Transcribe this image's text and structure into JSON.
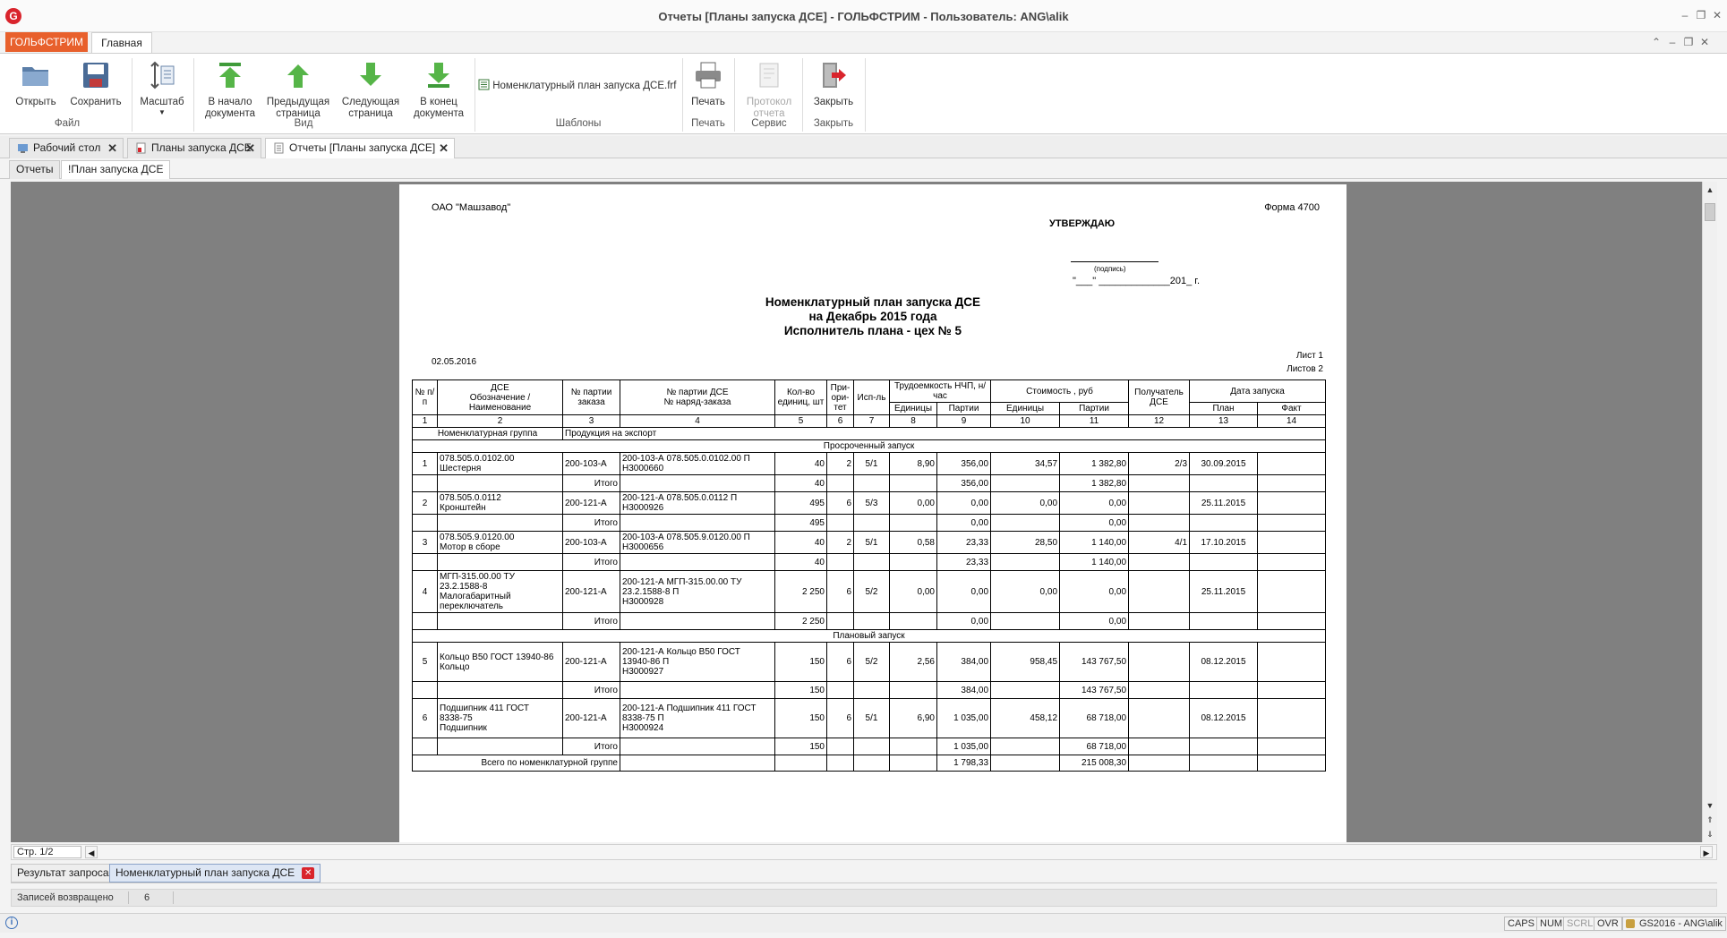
{
  "window": {
    "title": "Отчеты  [Планы запуска ДСЕ] - ГОЛЬФСТРИМ - Пользователь: ANG\\alik",
    "logo_letter": "G"
  },
  "ribbon": {
    "app_tab": "ГОЛЬФСТРИМ",
    "main_tab": "Главная",
    "buttons": {
      "open": "Открыть",
      "save": "Сохранить",
      "zoom": "Масштаб",
      "first_page": [
        "В начало",
        "документа"
      ],
      "prev_page": [
        "Предыдущая",
        "страница"
      ],
      "next_page": [
        "Следующая",
        "страница"
      ],
      "last_page": [
        "В конец",
        "документа"
      ],
      "template": "Номенклатурный план запуска ДСЕ.frf",
      "print": "Печать",
      "protocol": [
        "Протокол",
        "отчета"
      ],
      "close": "Закрыть"
    },
    "groups": {
      "file": "Файл",
      "view": "Вид",
      "templates": "Шаблоны",
      "print": "Печать",
      "service": "Сервис",
      "close": "Закрыть"
    }
  },
  "doc_tabs": [
    {
      "label": "Рабочий стол"
    },
    {
      "label": "Планы запуска ДСЕ"
    },
    {
      "label": "Отчеты  [Планы запуска ДСЕ]"
    }
  ],
  "sub_tabs": [
    "Отчеты",
    "!План запуска ДСЕ"
  ],
  "report": {
    "org": "ОАО \"Машзавод\"",
    "form": "Форма 4700",
    "approve": "УТВЕРЖДАЮ",
    "sign_caption": "(подпись)",
    "date_line": "\"___\" _____________201_ г.",
    "title1": "Номенклатурный план запуска ДСЕ",
    "title2": "на Декабрь 2015 года",
    "title3": "Исполнитель плана - цех № 5",
    "date": "02.05.2016",
    "sheet": "Лист 1",
    "sheets": "Листов 2",
    "headers": {
      "num": "№ п/п",
      "dse": "ДСЕ",
      "dse_sub": "Обозначение / Наименование",
      "batch": "№ партии заказа",
      "batch_dse": "№ партии ДСЕ",
      "work_order": "№ наряд-заказа",
      "qty": "Кол-во единиц, шт",
      "priority": "При- ори- тет",
      "executor": "Исп-ль",
      "labor": "Трудоемкость НЧП, н/час",
      "cost": "Стоимость , руб",
      "receiver": "Получатель ДСЕ",
      "launch_date": "Дата запуска",
      "unit": "Единицы",
      "batch_col": "Партии",
      "plan": "План",
      "fact": "Факт",
      "col_numbers": [
        "1",
        "2",
        "3",
        "4",
        "5",
        "6",
        "7",
        "8",
        "9",
        "10",
        "11",
        "12",
        "13",
        "14"
      ]
    },
    "group_label": "Номенклатурная группа",
    "group_value": "Продукция на экспорт",
    "section_overdue": "Просроченный запуск",
    "section_planned": "Плановый запуск",
    "total_label": "Итого",
    "grand_total_label": "Всего по номенклатурной группе",
    "grand_total": {
      "labor_batch": "1 798,33",
      "cost_batch": "215 008,30"
    },
    "overdue_rows": [
      {
        "n": "1",
        "dse": [
          "078.505.0.0102.00",
          "Шестерня"
        ],
        "batch": "200-103-А",
        "order": [
          "200-103-А 078.505.0.0102.00 П",
          "Н3000660"
        ],
        "qty": "40",
        "prio": "2",
        "exec": "5/1",
        "lab_u": "8,90",
        "lab_b": "356,00",
        "cost_u": "34,57",
        "cost_b": "1 382,80",
        "recv": "2/3",
        "plan": "30.09.2015",
        "fact": "",
        "t_qty": "40",
        "t_lab": "356,00",
        "t_cost": "1 382,80"
      },
      {
        "n": "2",
        "dse": [
          "078.505.0.0112",
          "Кронштейн"
        ],
        "batch": "200-121-А",
        "order": [
          "200-121-А 078.505.0.0112 П",
          "Н3000926"
        ],
        "qty": "495",
        "prio": "6",
        "exec": "5/3",
        "lab_u": "0,00",
        "lab_b": "0,00",
        "cost_u": "0,00",
        "cost_b": "0,00",
        "recv": "",
        "plan": "25.11.2015",
        "fact": "",
        "t_qty": "495",
        "t_lab": "0,00",
        "t_cost": "0,00"
      },
      {
        "n": "3",
        "dse": [
          "078.505.9.0120.00",
          "Мотор в сборе"
        ],
        "batch": "200-103-А",
        "order": [
          "200-103-А 078.505.9.0120.00 П",
          "Н3000656"
        ],
        "qty": "40",
        "prio": "2",
        "exec": "5/1",
        "lab_u": "0,58",
        "lab_b": "23,33",
        "cost_u": "28,50",
        "cost_b": "1 140,00",
        "recv": "4/1",
        "plan": "17.10.2015",
        "fact": "",
        "t_qty": "40",
        "t_lab": "23,33",
        "t_cost": "1 140,00"
      },
      {
        "n": "4",
        "dse": [
          "МГП-315.00.00 ТУ",
          "23.2.1588-8",
          "Малогабаритный",
          "переключатель"
        ],
        "batch": "200-121-А",
        "order": [
          "200-121-А МГП-315.00.00 ТУ",
          "23.2.1588-8 П",
          "Н3000928"
        ],
        "qty": "2 250",
        "prio": "6",
        "exec": "5/2",
        "lab_u": "0,00",
        "lab_b": "0,00",
        "cost_u": "0,00",
        "cost_b": "0,00",
        "recv": "",
        "plan": "25.11.2015",
        "fact": "",
        "t_qty": "2 250",
        "t_lab": "0,00",
        "t_cost": "0,00"
      }
    ],
    "planned_rows": [
      {
        "n": "5",
        "dse": [
          "Кольцо В50 ГОСТ 13940-86",
          "Кольцо"
        ],
        "batch": "200-121-А",
        "order": [
          "200-121-А Кольцо В50 ГОСТ",
          "13940-86 П",
          "Н3000927"
        ],
        "qty": "150",
        "prio": "6",
        "exec": "5/2",
        "lab_u": "2,56",
        "lab_b": "384,00",
        "cost_u": "958,45",
        "cost_b": "143 767,50",
        "recv": "",
        "plan": "08.12.2015",
        "fact": "",
        "t_qty": "150",
        "t_lab": "384,00",
        "t_cost": "143 767,50"
      },
      {
        "n": "6",
        "dse": [
          "Подшипник 411 ГОСТ",
          "8338-75",
          "Подшипник"
        ],
        "batch": "200-121-А",
        "order": [
          "200-121-А Подшипник 411 ГОСТ",
          "8338-75 П",
          "Н3000924"
        ],
        "qty": "150",
        "prio": "6",
        "exec": "5/1",
        "lab_u": "6,90",
        "lab_b": "1 035,00",
        "cost_u": "458,12",
        "cost_b": "68 718,00",
        "recv": "",
        "plan": "08.12.2015",
        "fact": "",
        "t_qty": "150",
        "t_lab": "1 035,00",
        "t_cost": "68 718,00"
      }
    ]
  },
  "pager": {
    "label": "Стр. 1/2"
  },
  "bottom_tabs": [
    "Результат запроса",
    "Номенклатурный план запуска ДСЕ"
  ],
  "records": {
    "label": "Записей возвращено",
    "value": "6"
  },
  "status": {
    "caps": "CAPS",
    "num": "NUM",
    "scrl": "SCRL",
    "ovr": "OVR",
    "user": "GS2016 - ANG\\alik"
  },
  "colors": {
    "accent": "#e8602c",
    "brand_red": "#d9242c",
    "viewer_bg": "#808080"
  }
}
